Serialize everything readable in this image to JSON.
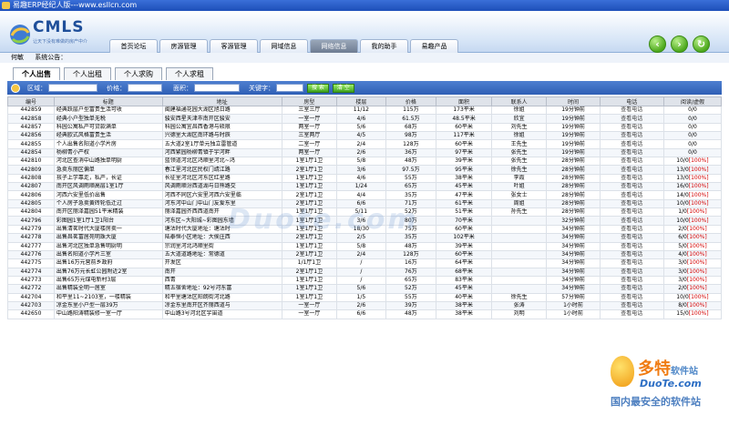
{
  "window": {
    "title": "易趣ERP经纪人版---www.esllcn.com"
  },
  "logo": {
    "text": "CMLS",
    "subtitle": "让天下没有难做的房产中介"
  },
  "nav": {
    "tabs": [
      "首页论坛",
      "房源管理",
      "客源管理",
      "网域信息",
      "网络信息",
      "我的助手",
      "易趣产品"
    ],
    "active": 4
  },
  "notice": {
    "user_label": "何敏",
    "announce_label": "系统公告："
  },
  "subtabs": {
    "items": [
      "个人出售",
      "个人出租",
      "个人求购",
      "个人求租"
    ],
    "active": 0
  },
  "search": {
    "area": "区域：",
    "price": "价格：",
    "size": "面积：",
    "keyword": "关键字：",
    "search_btn": "搜 索",
    "clear_btn": "清 空"
  },
  "table": {
    "headers": [
      "编号",
      "标题",
      "地址",
      "房型",
      "楼层",
      "价格",
      "面积",
      "联系人",
      "时间",
      "电话",
      "阅读/虚假"
    ],
    "rows": [
      [
        "442859",
        "经典跃层户型富贵生活可收",
        "闽建福通花园大湖区旭日路",
        "三室三厅",
        "11/12",
        "115万",
        "173平米",
        "徐姐",
        "19分钟前",
        "查看电话",
        "0/0",
        ""
      ],
      [
        "442858",
        "经典小户型独单无税",
        "骏安西星天津市南开区骏安",
        "一室一厅",
        "4/6",
        "61.5万",
        "48.5平米",
        "欣宜",
        "19分钟前",
        "查看电话",
        "0/0",
        ""
      ],
      [
        "442857",
        "科园公寓私产可贷款满单",
        "科园公寓宜昌西香港与硕限",
        "两室一厅",
        "5/6",
        "68万",
        "60平米",
        "刘先生",
        "19分钟前",
        "查看电话",
        "0/0",
        ""
      ],
      [
        "442856",
        "经典欧式风格富贵生活",
        "兴德里大湖区南环路与时辰",
        "三室两厅",
        "4/5",
        "98万",
        "117平米",
        "徐姐",
        "19分钟前",
        "查看电话",
        "0/0",
        ""
      ],
      [
        "442855",
        "个人出售名阳道小学片房",
        "五大道2室1厅单元独立雷管道",
        "二室一厅",
        "2/4",
        "128万",
        "60平米",
        "王先生",
        "19分钟前",
        "查看电话",
        "0/0",
        ""
      ],
      [
        "442854",
        "杨柳青小产权",
        "河西繁园杨柳青镇于宇河畔",
        "两室一厅",
        "2/6",
        "36万",
        "97平米",
        "张先生",
        "19分钟前",
        "查看电话",
        "0/0",
        ""
      ],
      [
        "442810",
        "河北区查消中山路独单明厨",
        "蓝领道河北区鸿顺里河北~鸿",
        "1室1厅1卫",
        "5/8",
        "48万",
        "39平米",
        "张先生",
        "28分钟前",
        "查看电话",
        "10/0",
        "[100%]"
      ],
      [
        "442809",
        "急卖东丽区偏单",
        "春江里河北区民权门靖江路",
        "2室1厅1卫",
        "3/6",
        "97.5万",
        "95平米",
        "徐先生",
        "28分钟前",
        "查看电话",
        "13/0",
        "[100%]"
      ],
      [
        "442808",
        "孩子上学靠走，私产，长证",
        "长征里河北区河东区红星路",
        "1室1厅1卫",
        "4/6",
        "55万",
        "38平米",
        "李霞",
        "28分钟前",
        "查看电话",
        "13/0",
        "[100%]"
      ],
      [
        "442807",
        "南开区风调雨顺高层1室1厅",
        "风调雨顺汾西道湖与日熊路交",
        "1室1厅1卫",
        "1/24",
        "65万",
        "45平米",
        "叶姐",
        "28分钟前",
        "查看电话",
        "16/0",
        "[100%]"
      ],
      [
        "442806",
        "河西六安里低价出售",
        "河西不同区六安里河西六安里临",
        "2室1厅1卫",
        "4/4",
        "35万",
        "47平米",
        "张女士",
        "28分钟前",
        "查看电话",
        "14/0",
        "[100%]"
      ],
      [
        "442805",
        "个人房子急卖黄砖轮低迁过",
        "河东河中山门中山门友爱东里",
        "2室1厅1卫",
        "6/6",
        "71万",
        "61平米",
        "周姐",
        "28分钟前",
        "查看电话",
        "10/0",
        "[100%]"
      ],
      [
        "442804",
        "南开区丽泽嘉园51平米精装",
        "丽泽嘉园齐西西道南开",
        "1室1厅1卫",
        "5/11",
        "52万",
        "51平米",
        "孙先生",
        "28分钟前",
        "查看电话",
        "1/0",
        "[100%]"
      ],
      [
        "442796",
        "彩图园1室1厅1卫1阳台",
        "河东区~大阳城~彩图园东墙",
        "1室1厅1卫",
        "3/6",
        "80万",
        "70平米",
        "",
        "32分钟前",
        "查看电话",
        "10/0",
        "[100%]"
      ],
      [
        "442779",
        "出售清茗时代大厦楼房卖一",
        "塘沽时代大厦地址：塘沽时",
        "1室1厅1卫",
        "18/30",
        "75万",
        "60平米",
        "",
        "34分钟前",
        "查看电话",
        "2/0",
        "[100%]"
      ],
      [
        "442778",
        "出售昌茗富居苑明珠大厦",
        "陆泰恒小区地址：大侯庄西",
        "2室1厅1卫",
        "2/5",
        "35万",
        "102平米",
        "",
        "34分钟前",
        "查看电话",
        "6/0",
        "[100%]"
      ],
      [
        "442777",
        "出售河北区独单急售明厨明",
        "宗润里河北鸿顺里街",
        "1室1厅1卫",
        "5/8",
        "48万",
        "39平米",
        "",
        "34分钟前",
        "查看电话",
        "5/0",
        "[100%]"
      ],
      [
        "442776",
        "出售名阳道小学片三室",
        "五大道道路地址：常德道",
        "2室1厅1卫",
        "2/4",
        "128万",
        "60平米",
        "",
        "34分钟前",
        "查看电话",
        "4/0",
        "[100%]"
      ],
      [
        "442775",
        "出售16万元营前乡政府",
        "开发区",
        "1/1厅1卫",
        "/",
        "16万",
        "64平米",
        "",
        "34分钟前",
        "查看电话",
        "3/0",
        "[100%]"
      ],
      [
        "442774",
        "出售76万元长虹公园附近2室",
        "南开",
        "2室1厅1卫",
        "/",
        "76万",
        "68平米",
        "",
        "34分钟前",
        "查看电话",
        "3/0",
        "[100%]"
      ],
      [
        "442773",
        "出售65万元煤电新村3层",
        "西青",
        "1室1厅1卫",
        "/",
        "65万",
        "83平米",
        "",
        "34分钟前",
        "查看电话",
        "3/0",
        "[100%]"
      ],
      [
        "442772",
        "出售精装全明一居室",
        "精五宿舍地址：92号河东富",
        "1室1厅1卫",
        "5/6",
        "52万",
        "45平米",
        "",
        "34分钟前",
        "查看电话",
        "2/0",
        "[100%]"
      ],
      [
        "442704",
        "和平里11~2103室，一楼精装",
        "和平里塘沽区阳朗街河北路",
        "1室1厅1卫",
        "1/5",
        "55万",
        "40平米",
        "徐先生",
        "57分钟前",
        "查看电话",
        "10/0",
        "[100%]"
      ],
      [
        "442703",
        "凉金东里小户型一层39万",
        "凉金东里南开区齐丽西道与",
        "一室一厅",
        "2/6",
        "39万",
        "38平米",
        "张涛",
        "1小时前",
        "查看电话",
        "8/0",
        "[100%]"
      ],
      [
        "442650",
        "中山路阳涛精装修一室一厅",
        "中山路3号河北区宇宙道",
        "一室一厅",
        "6/6",
        "48万",
        "38平米",
        "刘明",
        "1小时前",
        "查看电话",
        "15/0",
        "[100%]"
      ]
    ]
  },
  "watermark": {
    "center": "Duote.com",
    "brand": "多特",
    "brand_suffix": "软件站",
    "domain": "DuoTe.com",
    "slogan": "国内最安全的软件站"
  }
}
